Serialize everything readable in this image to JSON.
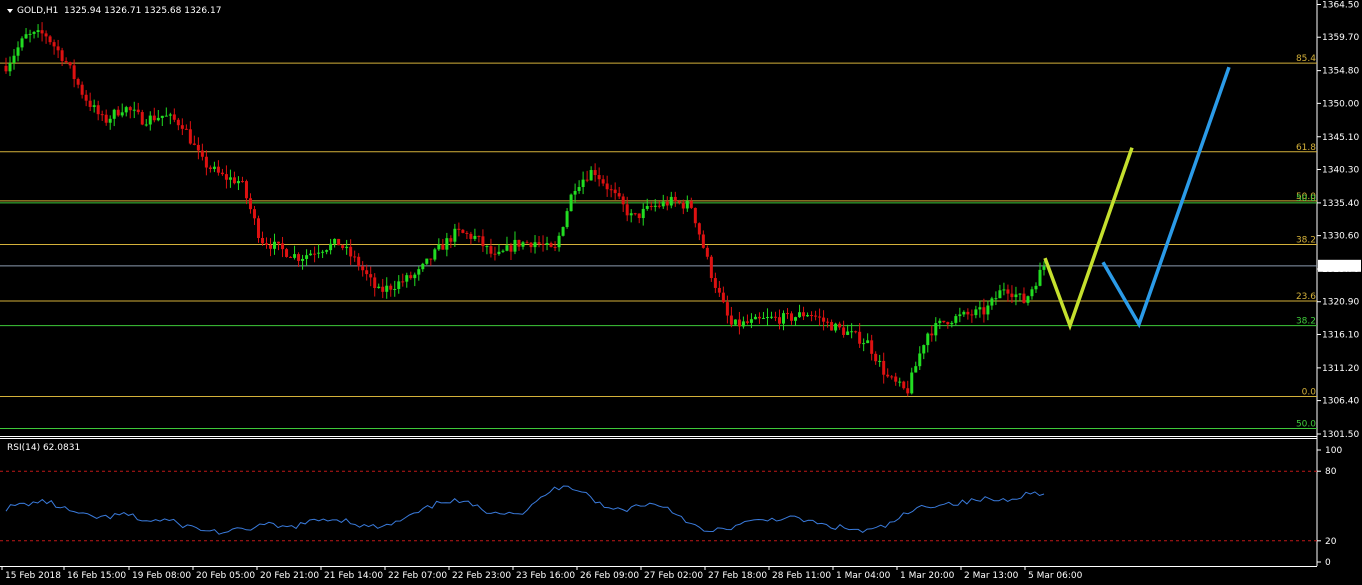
{
  "header": {
    "symbol": "GOLD,H1",
    "ohlc": "1325.94 1326.71 1325.68 1326.17"
  },
  "price_panel": {
    "ylim": [
      1300.0,
      1364.9
    ],
    "y_ticks": [
      1364.5,
      1359.7,
      1354.8,
      1350.0,
      1345.1,
      1340.3,
      1335.4,
      1330.6,
      1325.7,
      1320.9,
      1316.1,
      1311.2,
      1306.4,
      1301.5
    ],
    "current_price_label": "1326.17",
    "current_price": 1326.17
  },
  "rsi_panel": {
    "label": "RSI(14) 62.0831",
    "ylim": [
      0,
      100
    ],
    "y_ticks": [
      100,
      80,
      20,
      0
    ],
    "levels": [
      80,
      20
    ]
  },
  "x_axis": {
    "labels": [
      "15 Feb 2018",
      "16 Feb 15:00",
      "19 Feb 08:00",
      "20 Feb 05:00",
      "20 Feb 21:00",
      "21 Feb 14:00",
      "22 Feb 07:00",
      "22 Feb 23:00",
      "23 Feb 16:00",
      "26 Feb 09:00",
      "27 Feb 02:00",
      "27 Feb 18:00",
      "28 Feb 11:00",
      "1 Mar 04:00",
      "1 Mar 20:00",
      "2 Mar 13:00",
      "5 Mar 06:00"
    ]
  },
  "fib_levels": [
    {
      "label": "85.4",
      "price": 1355.9,
      "color": "#d4b13a"
    },
    {
      "label": "61.8",
      "price": 1342.9,
      "color": "#d4b13a"
    },
    {
      "label": "50.0",
      "price": 1335.7,
      "color": "#d4b13a"
    },
    {
      "label": "38.2",
      "price": 1329.3,
      "color": "#d4b13a"
    },
    {
      "label": "23.6",
      "price": 1321.0,
      "color": "#d4b13a"
    },
    {
      "label": "0.0",
      "price": 1307.0,
      "color": "#d4b13a"
    },
    {
      "label": "50.0",
      "price": 1335.4,
      "color": "#3ec93a"
    },
    {
      "label": "38.2",
      "price": 1317.4,
      "color": "#3ec93a"
    },
    {
      "label": "50.0",
      "price": 1302.3,
      "color": "#3ec93a"
    }
  ],
  "colors": {
    "background": "#000000",
    "bull_candle": "#22dd22",
    "bear_candle": "#dd1111",
    "grid_axis": "#ffffff",
    "price_line": "#8c9bb0",
    "rsi_line": "#3a7bdc",
    "rsi_level": "#c01818",
    "scenario_yellow": "#c5e02e",
    "scenario_blue": "#2b9be8"
  },
  "chart_data": {
    "type": "candlestick",
    "title": "GOLD,H1",
    "series": [
      {
        "name": "GOLD,H1",
        "values": [
          1355.5,
          1359.8,
          1360.2,
          1356.4,
          1351.0,
          1347.3,
          1349.5,
          1347.6,
          1348.2,
          1347.0,
          1341.5,
          1339.3,
          1338.5,
          1330.1,
          1328.6,
          1327.4,
          1328.7,
          1329.5,
          1326.4,
          1322.3,
          1323.6,
          1324.9,
          1328.3,
          1331.1,
          1330.3,
          1327.2,
          1329.4,
          1329.7,
          1328.2,
          1337.8,
          1340.3,
          1336.7,
          1333.1,
          1334.8,
          1335.6,
          1334.9,
          1325.1,
          1317.4,
          1317.8,
          1318.4,
          1318.5,
          1319.3,
          1317.6,
          1316.3,
          1314.9,
          1309.8,
          1307.6,
          1316.2,
          1318.2,
          1318.9,
          1319.5,
          1323.2,
          1320.9,
          1326.17
        ]
      }
    ],
    "scenarios": [
      {
        "name": "yellow",
        "points": [
          [
            0,
            1327.3
          ],
          [
            1,
            1317.4
          ],
          [
            2,
            1343.5
          ]
        ]
      },
      {
        "name": "blue",
        "points": [
          [
            0,
            1326.7
          ],
          [
            1,
            1317.6
          ],
          [
            2,
            1355.3
          ]
        ]
      }
    ],
    "rsi": [
      48,
      52,
      54,
      47,
      41,
      40,
      43,
      37,
      38,
      33,
      29,
      27,
      30,
      34,
      31,
      35,
      39,
      38,
      32,
      32,
      39,
      47,
      55,
      53,
      46,
      45,
      44,
      60,
      69,
      62,
      48,
      47,
      52,
      50,
      39,
      27,
      30,
      35,
      38,
      40,
      38,
      33,
      31,
      28,
      32,
      42,
      50,
      52,
      53,
      56,
      55,
      60,
      62
    ]
  }
}
